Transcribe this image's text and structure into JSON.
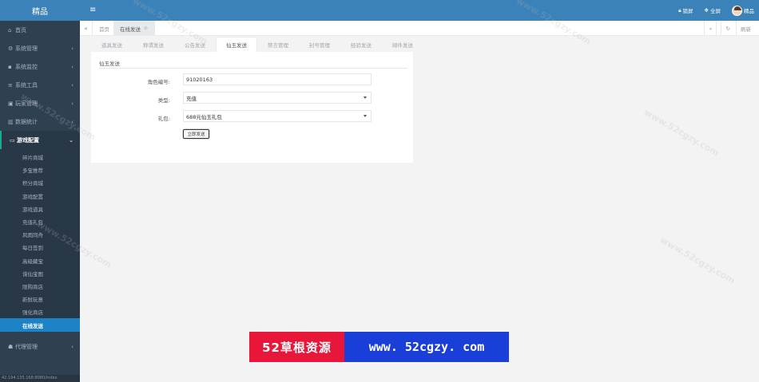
{
  "app": {
    "brand": "精品"
  },
  "topbar": {
    "lock_label": "锁屏",
    "fullscreen_label": "全屏",
    "user_name": "精品"
  },
  "sidebar": {
    "items": [
      {
        "icon": "home-icon",
        "label": "首页"
      },
      {
        "icon": "gear-icon",
        "label": "系统管理"
      },
      {
        "icon": "video-icon",
        "label": "系统监控"
      },
      {
        "icon": "bars-icon",
        "label": "系统工具"
      },
      {
        "icon": "user-card-icon",
        "label": "玩家管理"
      },
      {
        "icon": "chart-icon",
        "label": "数据统计"
      },
      {
        "icon": "desktop-icon",
        "label": "游戏配置"
      },
      {
        "icon": "group-icon",
        "label": "代理管理"
      }
    ],
    "sub_items": [
      "碎片商城",
      "多宝推荐",
      "积分商城",
      "游戏配置",
      "游戏道具",
      "充值礼包",
      "风雨同舟",
      "每日签到",
      "高级藏宝",
      "诛仙宝图",
      "限购商店",
      "新鲜玩意",
      "强化商店",
      "在线发送"
    ],
    "status_url": "42.194.135.168:8080/index"
  },
  "content_tabs": {
    "items": [
      {
        "label": "首页"
      },
      {
        "label": "在线发送"
      }
    ],
    "refresh_label": "刷新"
  },
  "sub_tabs": [
    "道具发送",
    "称谓发送",
    "公告发送",
    "仙玉发送",
    "禁言管理",
    "封号管理",
    "经验发送",
    "邮件发送"
  ],
  "form": {
    "title": "仙玉发送",
    "fields": [
      {
        "label": "角色编号:",
        "value": "91020163"
      },
      {
        "label": "类型:",
        "value": "充值"
      },
      {
        "label": "礼包:",
        "value": "688元仙玉礼包"
      }
    ],
    "submit_label": "立即发送"
  },
  "banner": {
    "left_text": "52草根资源",
    "right_text": "www. 52cgzy. com"
  },
  "watermark_text": "www.52cgzy.com"
}
